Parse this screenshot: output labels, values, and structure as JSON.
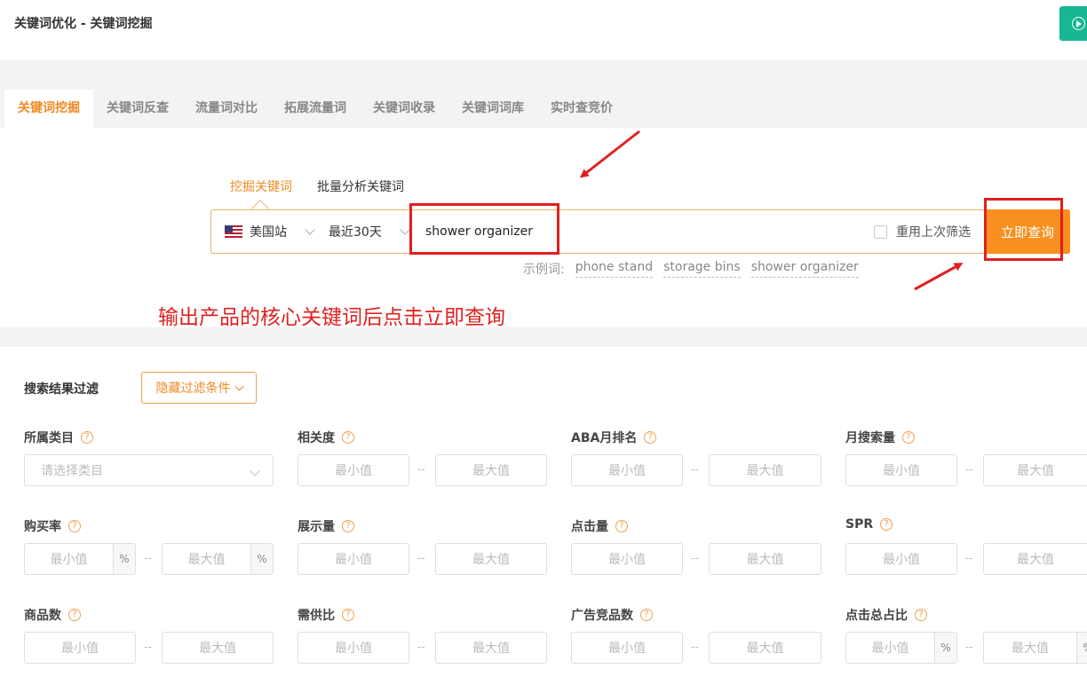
{
  "header": {
    "title": "关键词优化 - 关键词挖掘"
  },
  "tabs": [
    "关键词挖掘",
    "关键词反查",
    "流量词对比",
    "拓展流量词",
    "关键词收录",
    "关键词词库",
    "实时查竞价"
  ],
  "search": {
    "subtabs": [
      "挖掘关键词",
      "批量分析关键词"
    ],
    "site": "美国站",
    "range": "最近30天",
    "keyword": "shower organizer",
    "reuse_label": "重用上次筛选",
    "query_button": "立即查询",
    "examples_label": "示例词:",
    "examples": [
      "phone stand",
      "storage bins",
      "shower organizer"
    ]
  },
  "instruction": "输出产品的核心关键词后点击立即查询",
  "filter": {
    "title": "搜索结果过滤",
    "hide_button": "隐藏过滤条件",
    "min_placeholder": "最小值",
    "max_placeholder": "最大值",
    "category_placeholder": "请选择类目",
    "percent": "%",
    "dash": "--",
    "question": "?",
    "labels": [
      "所属类目",
      "相关度",
      "ABA月排名",
      "月搜索量",
      "购买率",
      "展示量",
      "点击量",
      "SPR",
      "商品数",
      "需供比",
      "广告竞品数",
      "点击总占比"
    ]
  },
  "colors": {
    "accent": "#f7901e",
    "annotation": "#e02020",
    "corner_button": "#17b794"
  }
}
